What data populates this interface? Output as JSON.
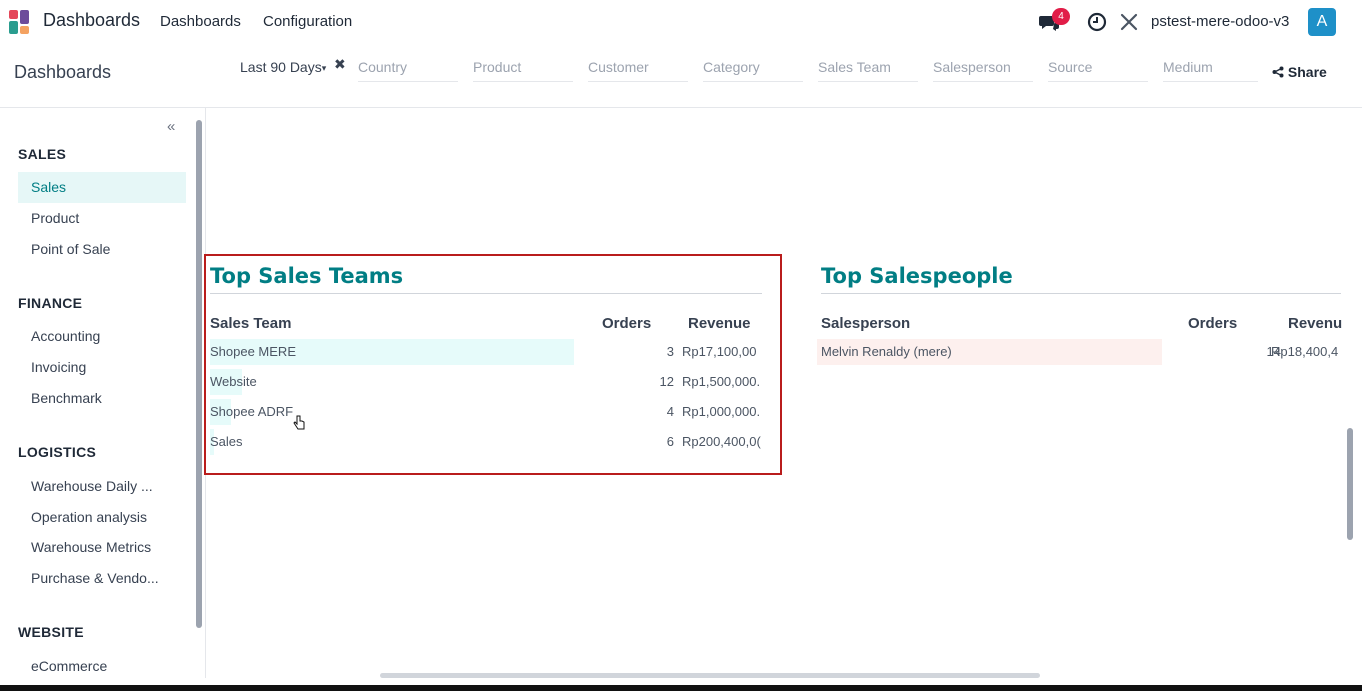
{
  "navbar": {
    "app_title": "Dashboards",
    "menu": [
      "Dashboards",
      "Configuration"
    ],
    "notification_count": "4",
    "company": "pstest-mere-odoo-v3",
    "avatar_letter": "A"
  },
  "control": {
    "breadcrumb": "Dashboards",
    "filters": {
      "period": "Last 90 Days",
      "country": "Country",
      "product": "Product",
      "customer": "Customer",
      "category": "Category",
      "sales_team": "Sales Team",
      "salesperson": "Salesperson",
      "source": "Source",
      "medium": "Medium"
    },
    "share_label": "Share"
  },
  "sidebar": {
    "collapse_icon": "«",
    "sections": [
      {
        "title": "SALES",
        "items": [
          "Sales",
          "Product",
          "Point of Sale"
        ]
      },
      {
        "title": "FINANCE",
        "items": [
          "Accounting",
          "Invoicing",
          "Benchmark"
        ]
      },
      {
        "title": "LOGISTICS",
        "items": [
          "Warehouse Daily ...",
          "Operation analysis",
          "Warehouse Metrics",
          "Purchase & Vendo..."
        ]
      },
      {
        "title": "WEBSITE",
        "items": [
          "eCommerce"
        ]
      }
    ],
    "active_item": "Sales"
  },
  "top_sales_teams": {
    "title": "Top Sales Teams",
    "headers": {
      "name": "Sales Team",
      "orders": "Orders",
      "revenue": "Revenue"
    },
    "rows": [
      {
        "name": "Shopee MERE",
        "orders": "3",
        "revenue": "Rp17,100,00",
        "share": 1.0
      },
      {
        "name": "Website",
        "orders": "12",
        "revenue": "Rp1,500,000.",
        "share": 0.088
      },
      {
        "name": "Shopee ADRF",
        "orders": "4",
        "revenue": "Rp1,000,000.",
        "share": 0.058
      },
      {
        "name": "Sales",
        "orders": "6",
        "revenue": "Rp200,400,0(",
        "share": 0.012
      }
    ]
  },
  "top_salespeople": {
    "title": "Top Salespeople",
    "headers": {
      "name": "Salesperson",
      "orders": "Orders",
      "revenue": "Revenu"
    },
    "rows": [
      {
        "name": "Melvin Renaldy (mere)",
        "orders": "14",
        "revenue": "Rp18,400,4",
        "share": 1.0
      }
    ]
  },
  "colors": {
    "accent": "#017e84",
    "active_bg": "#e6f7f7",
    "team_bar": "#e6fbfa",
    "person_bar": "#fdf0ee",
    "highlight_border": "#b91c1c"
  }
}
